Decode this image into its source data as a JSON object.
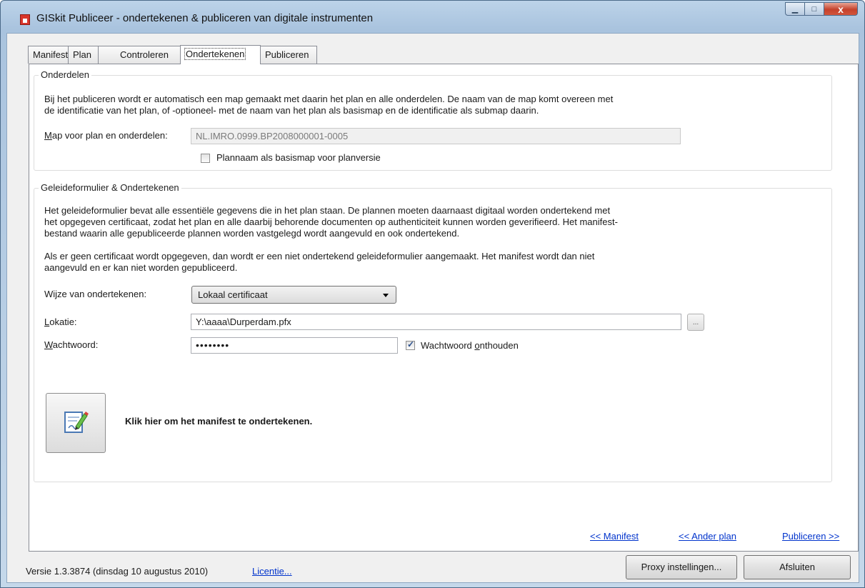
{
  "window": {
    "title": "GISkit Publiceer - ondertekenen & publiceren van digitale instrumenten",
    "minimize_glyph": "▁",
    "maximize_glyph": "□",
    "close_glyph": "x"
  },
  "tabs": [
    {
      "label": "Manifest"
    },
    {
      "label": "Plan"
    },
    {
      "label": "Controleren"
    },
    {
      "label": "Ondertekenen",
      "active": true
    },
    {
      "label": "Publiceren"
    }
  ],
  "onderdelen": {
    "legend": "Onderdelen",
    "desc_line1": "Bij het publiceren wordt er automatisch een map gemaakt met daarin het plan en alle onderdelen. De naam van de map komt overeen met",
    "desc_line2": "de identificatie van het plan, of -optioneel- met de naam van het plan als basismap en de identificatie als submap daarin.",
    "map_label_accesskey": "M",
    "map_label_rest": "ap voor plan en onderdelen:",
    "map_value": "NL.IMRO.0999.BP2008000001-0005",
    "basismap_label": "Plannaam als basismap voor planversie",
    "basismap_checked": false
  },
  "geleide": {
    "legend": "Geleideformulier & Ondertekenen",
    "desc1_line1": "Het geleideformulier bevat alle essentiële gegevens die in het plan staan. De plannen moeten daarnaast digitaal worden ondertekend met",
    "desc1_line2": "het opgegeven certificaat, zodat het plan en alle daarbij behorende documenten op authenticiteit kunnen worden geverifieerd. Het manifest-",
    "desc1_line3": "bestand waarin alle gepubliceerde plannen worden vastgelegd wordt aangevuld en ook ondertekend.",
    "desc2_line1": "Als er geen certificaat wordt opgegeven, dan wordt er een niet ondertekend geleideformulier aangemaakt. Het manifest wordt dan niet",
    "desc2_line2": "aangevuld en er kan niet worden gepubliceerd.",
    "wijze_label": "Wijze van ondertekenen:",
    "wijze_value": "Lokaal certificaat",
    "lokatie_accesskey": "L",
    "lokatie_rest": "okatie:",
    "lokatie_value": "Y:\\aaaa\\Durperdam.pfx",
    "browse_label": "...",
    "wachtwoord_accesskey": "W",
    "wachtwoord_rest": "achtwoord:",
    "wachtwoord_value": "••••••••",
    "onthouden_prefix": "Wachtwoord ",
    "onthouden_accesskey": "o",
    "onthouden_rest": "nthouden",
    "onthouden_checked": true,
    "sign_label": "Klik hier om het manifest te ondertekenen."
  },
  "nav": {
    "manifest": "<< Manifest",
    "ander_plan": "<< Ander plan",
    "publiceren": "Publiceren >>"
  },
  "footer": {
    "version": "Versie 1.3.3874 (dinsdag 10 augustus 2010)",
    "licentie": "Licentie...",
    "proxy": "Proxy instellingen...",
    "afsluiten": "Afsluiten"
  },
  "colors": {
    "link": "#0033cc",
    "titlebar": "#bcd3e9",
    "close_button": "#c5412b"
  },
  "icons": {
    "app": "giskit-app-icon",
    "sign": "sign-document-icon"
  }
}
